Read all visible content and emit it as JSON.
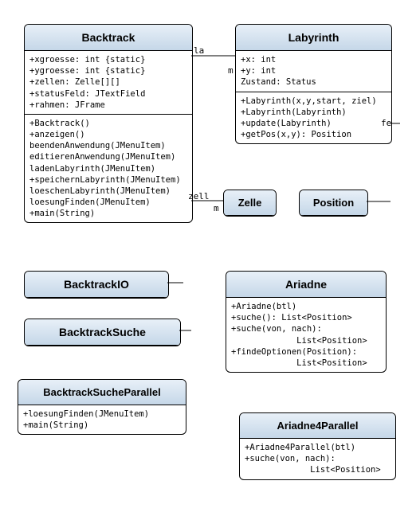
{
  "classes": {
    "backtrack": {
      "name": "Backtrack",
      "attrs": [
        "+xgroesse: int {static}",
        "+ygroesse: int {static}",
        "+zellen: Zelle[][]",
        "+statusFeld: JTextField",
        "+rahmen: JFrame"
      ],
      "ops": [
        "+Backtrack()",
        "+anzeigen()",
        "beendenAnwendung(JMenuItem)",
        "editierenAnwendung(JMenuItem)",
        "ladenLabyrinth(JMenuItem)",
        "+speichernLabyrinth(JMenuItem)",
        "loeschenLabyrinth(JMenuItem)",
        "loesungFinden(JMenuItem)",
        "+main(String)"
      ]
    },
    "labyrinth": {
      "name": "Labyrinth",
      "attrs": [
        "+x: int",
        "+y: int",
        "Zustand: Status"
      ],
      "ops": [
        "+Labyrinth(x,y,start, ziel)",
        "+Labyrinth(Labyrinth)",
        "+update(Labyrinth)",
        "+getPos(x,y): Position"
      ]
    },
    "zelle": {
      "name": "Zelle"
    },
    "position": {
      "name": "Position"
    },
    "backtrackio": {
      "name": "BacktrackIO"
    },
    "backtracksuche": {
      "name": "BacktrackSuche"
    },
    "backtracksp": {
      "name": "BacktrackSucheParallel",
      "ops": [
        "+loesungFinden(JMenuItem)",
        "+main(String)"
      ]
    },
    "ariadne": {
      "name": "Ariadne",
      "ops": [
        "+Ariadne(btl)",
        "+suche(): List<Position>",
        "+suche(von, nach):",
        "             List<Position>",
        "+findeOptionen(Position):",
        "             List<Position>"
      ]
    },
    "ariadne4p": {
      "name": "Ariadne4Parallel",
      "ops": [
        "+Ariadne4Parallel(btl)",
        "+suche(von, nach):",
        "             List<Position>"
      ]
    }
  },
  "labels": {
    "la": "la",
    "m": "m",
    "fe": "fe",
    "zell": "zell",
    "m2": "m"
  },
  "chart_data": {
    "type": "table",
    "title": "UML Class Diagram",
    "classes": [
      {
        "name": "Backtrack",
        "attributes": [
          "+xgroesse: int {static}",
          "+ygroesse: int {static}",
          "+zellen: Zelle[][]",
          "+statusFeld: JTextField",
          "+rahmen: JFrame"
        ],
        "operations": [
          "+Backtrack()",
          "+anzeigen()",
          "beendenAnwendung(JMenuItem)",
          "editierenAnwendung(JMenuItem)",
          "ladenLabyrinth(JMenuItem)",
          "+speichernLabyrinth(JMenuItem)",
          "loeschenLabyrinth(JMenuItem)",
          "loesungFinden(JMenuItem)",
          "+main(String)"
        ]
      },
      {
        "name": "Labyrinth",
        "attributes": [
          "+x: int",
          "+y: int",
          "Zustand: Status"
        ],
        "operations": [
          "+Labyrinth(x,y,start, ziel)",
          "+Labyrinth(Labyrinth)",
          "+update(Labyrinth)",
          "+getPos(x,y): Position"
        ]
      },
      {
        "name": "Zelle",
        "attributes": [],
        "operations": []
      },
      {
        "name": "Position",
        "attributes": [],
        "operations": []
      },
      {
        "name": "BacktrackIO",
        "attributes": [],
        "operations": []
      },
      {
        "name": "BacktrackSuche",
        "attributes": [],
        "operations": []
      },
      {
        "name": "BacktrackSucheParallel",
        "attributes": [],
        "operations": [
          "+loesungFinden(JMenuItem)",
          "+main(String)"
        ]
      },
      {
        "name": "Ariadne",
        "attributes": [],
        "operations": [
          "+Ariadne(btl)",
          "+suche(): List<Position>",
          "+suche(von, nach): List<Position>",
          "+findeOptionen(Position): List<Position>"
        ]
      },
      {
        "name": "Ariadne4Parallel",
        "attributes": [],
        "operations": [
          "+Ariadne4Parallel(btl)",
          "+suche(von, nach): List<Position>"
        ]
      }
    ],
    "associations": [
      {
        "from": "Backtrack",
        "label": "la",
        "to": "Labyrinth"
      },
      {
        "from": "Labyrinth",
        "label": "m",
        "to": ""
      },
      {
        "from": "Labyrinth",
        "label": "fe",
        "to": ""
      },
      {
        "from": "Backtrack",
        "label": "zell",
        "to": "Zelle"
      },
      {
        "from": "Zelle",
        "label": "m",
        "to": ""
      }
    ]
  }
}
